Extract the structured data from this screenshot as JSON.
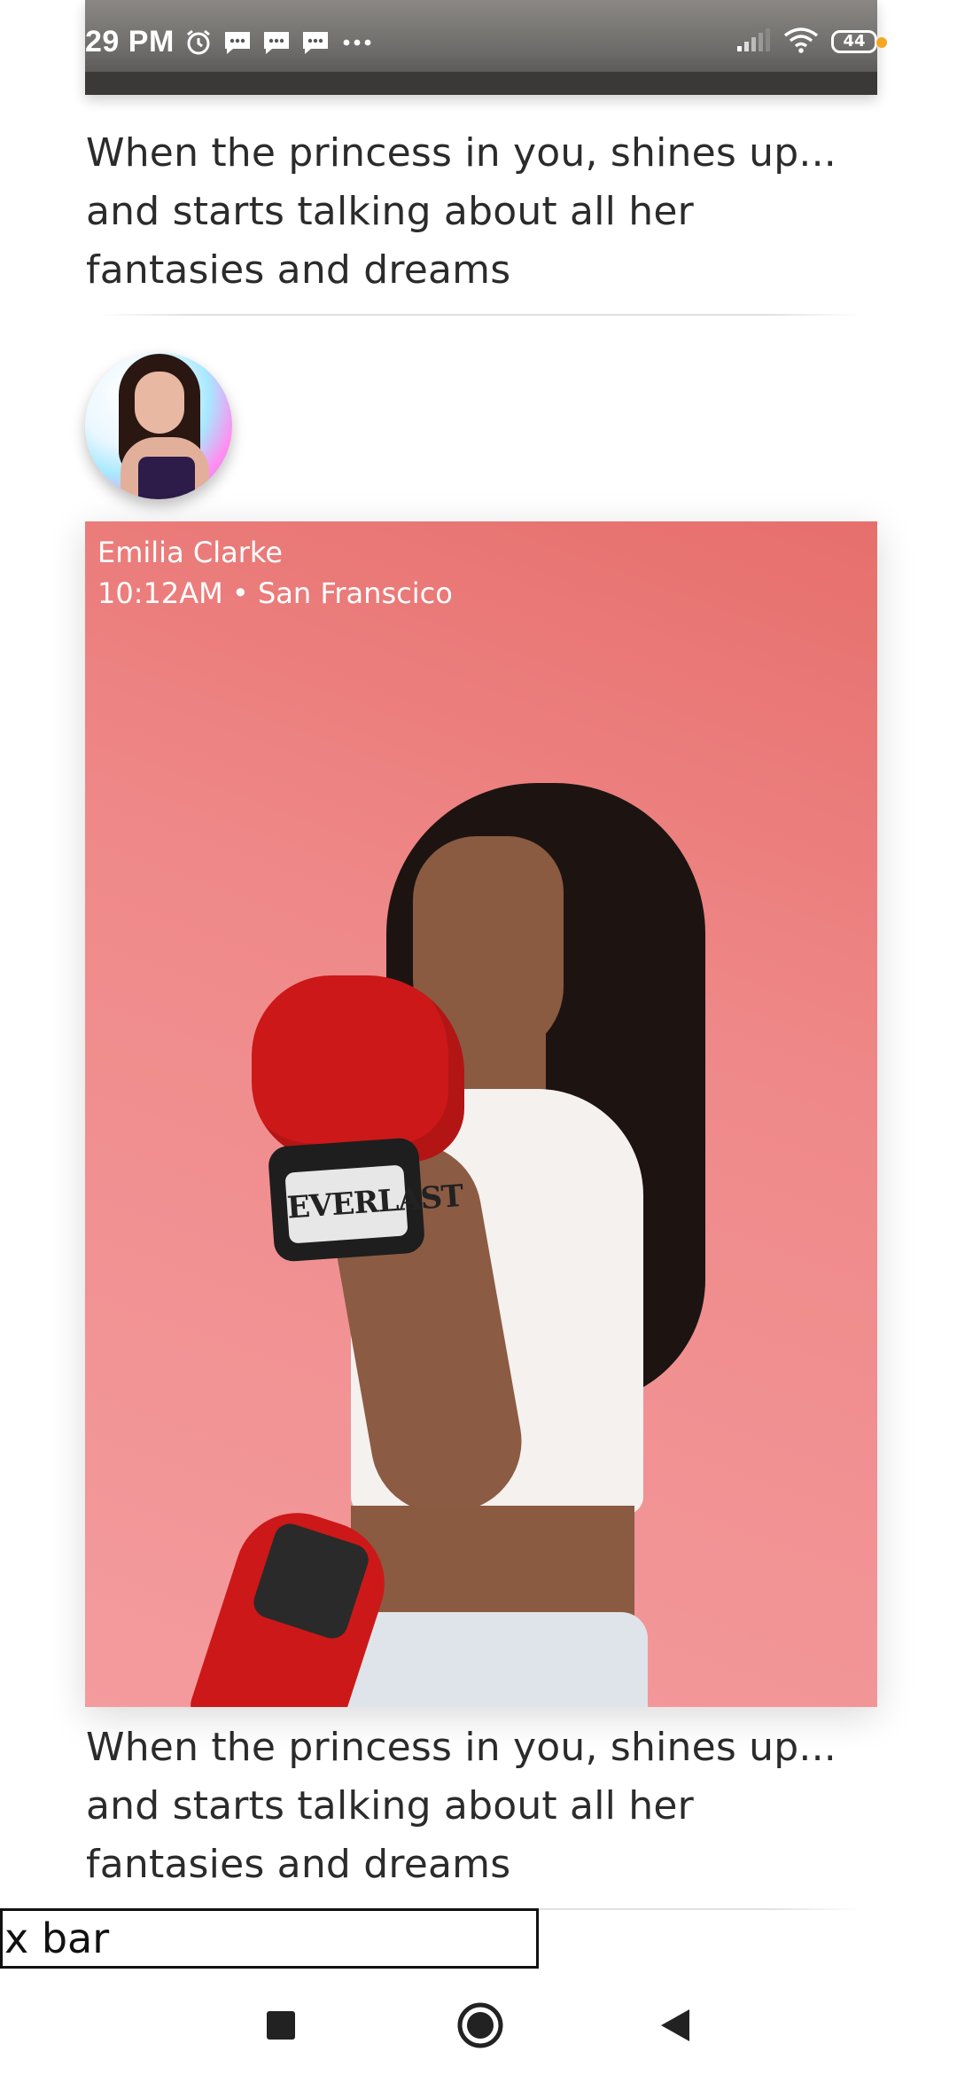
{
  "status_bar": {
    "time": "29 PM",
    "battery": "44",
    "icons": [
      "alarm-icon",
      "message-icon",
      "message-icon",
      "message-icon",
      "more-dots-icon",
      "signal-icon",
      "wifi-icon",
      "battery-icon"
    ]
  },
  "feed": {
    "post_1": {
      "caption": "When the princess in you, shines up... and starts talking about all her fantasies and dreams"
    },
    "post_2": {
      "author": "Emilia Clarke",
      "meta": "10:12AM • San Franscico",
      "glove_brand": "EVERLAST",
      "caption": "When the princess in you, shines up... and starts talking about all her fantasies and dreams"
    }
  },
  "search": {
    "value": "x bar"
  },
  "nav": {
    "icons": [
      "recents-square-icon",
      "home-circle-icon",
      "back-triangle-icon"
    ]
  },
  "colors": {
    "card_pink": "#ef8989",
    "glove_red": "#cc1818",
    "battery_dot": "#f5a623"
  }
}
